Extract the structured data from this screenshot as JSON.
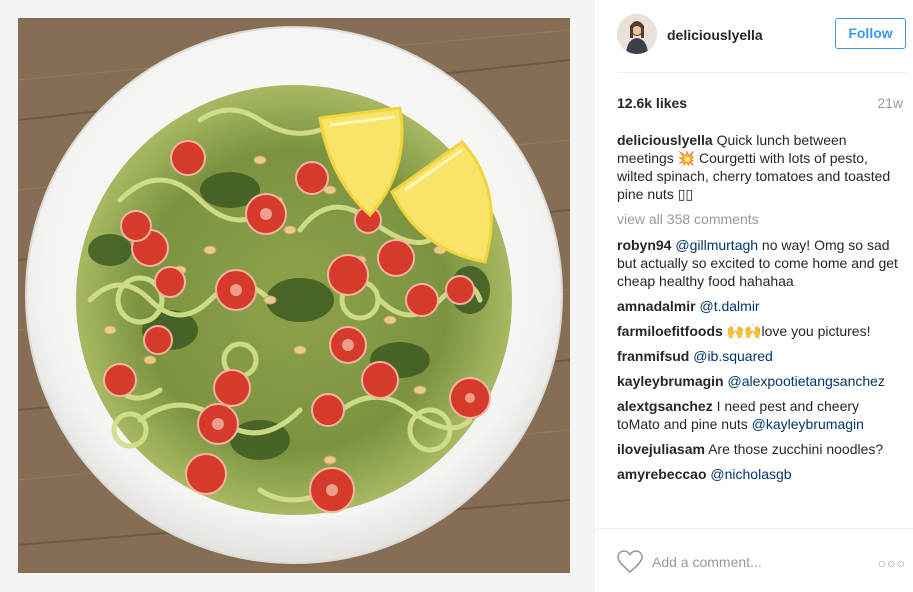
{
  "post": {
    "username": "deliciouslyella",
    "follow_label": "Follow",
    "likes": "12.6k likes",
    "age": "21w",
    "caption": {
      "user": "deliciouslyella",
      "text": "Quick lunch between meetings 💥 Courgetti with lots of pesto, wilted spinach, cherry tomatoes and toasted pine nuts ▯▯"
    },
    "view_all": "view all 358 comments",
    "comments": [
      {
        "user": "robyn94",
        "mention": "@gillmurtagh",
        "text": " no way! Omg so sad but actually so excited to come home and get cheap healthy food hahahaa"
      },
      {
        "user": "amnadalmir",
        "mention": "@t.dalmir",
        "text": ""
      },
      {
        "user": "farmiloefitfoods",
        "mention": "",
        "text": "🙌🙌love you pictures!"
      },
      {
        "user": "franmifsud",
        "mention": "@ib.squared",
        "text": ""
      },
      {
        "user": "kayleybrumagin",
        "mention": "@alexpootietangsanchez",
        "text": ""
      },
      {
        "user": "alextgsanchez",
        "mention": "",
        "text": "I need pest and cheery toMato and pine nuts ",
        "mention_after": "@kayleybrumagin"
      },
      {
        "user": "ilovejuliasam",
        "mention": "",
        "text": "Are those zucchini noodles?"
      },
      {
        "user": "amyrebeccao",
        "mention": "@nicholasgb",
        "text": ""
      }
    ],
    "add_comment_placeholder": "Add a comment...",
    "more_label": "○○○"
  },
  "colors": {
    "accent": "#3897f0",
    "mention": "#003569",
    "muted": "#999999",
    "wood": "#8a7257",
    "bowl": "#ffffff",
    "zucchini": "#c9d77a",
    "tomato": "#d93a2b",
    "lemon": "#f7e25a"
  }
}
